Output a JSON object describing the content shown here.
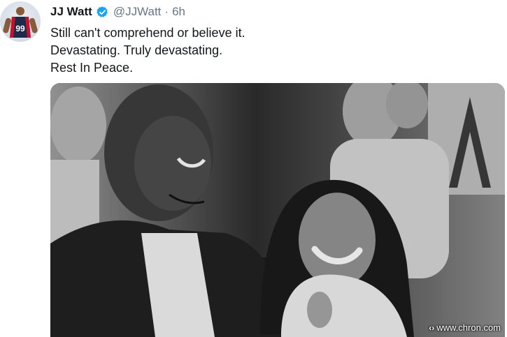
{
  "tweet": {
    "display_name": "JJ Watt",
    "handle": "@JJWatt",
    "separator": "·",
    "time": "6h",
    "verified": true,
    "text_lines": [
      "Still can't comprehend or believe it.",
      "Devastating. Truly devastating.",
      "Rest In Peace."
    ]
  },
  "avatar": {
    "jersey_number": "99",
    "jersey_color": "#1e2a4a",
    "accent_color": "#c8102e"
  },
  "media": {
    "watermark_glyph": "‹›",
    "watermark": "www.chron.com"
  },
  "colors": {
    "verified_badge": "#1da1f2",
    "secondary_text": "#657786",
    "primary_text": "#14171a"
  }
}
